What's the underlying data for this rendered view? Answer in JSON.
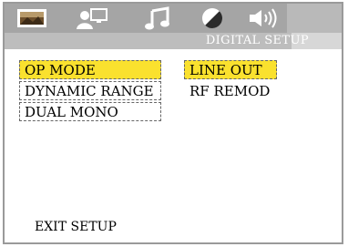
{
  "window": {
    "section_title": "DIGITAL SETUP"
  },
  "tabs": [
    {
      "icon": "tv-monitor-icon"
    },
    {
      "icon": "user-computer-icon"
    },
    {
      "icon": "music-note-icon"
    },
    {
      "icon": "contrast-icon"
    },
    {
      "icon": "speaker-icon"
    }
  ],
  "menu_left": {
    "items": [
      {
        "label": "OP MODE",
        "state": "selected"
      },
      {
        "label": "DYNAMIC RANGE",
        "state": "normal"
      },
      {
        "label": "DUAL MONO",
        "state": "normal"
      }
    ]
  },
  "menu_right": {
    "items": [
      {
        "label": "LINE OUT",
        "state": "selected"
      },
      {
        "label": "RF REMOD",
        "state": "normal"
      }
    ]
  },
  "footer": {
    "exit_label": "EXIT SETUP"
  },
  "colors": {
    "highlight": "#fae12e",
    "topbar": "#a5a5a5",
    "subtitle_bar": "#bdbdbd"
  }
}
